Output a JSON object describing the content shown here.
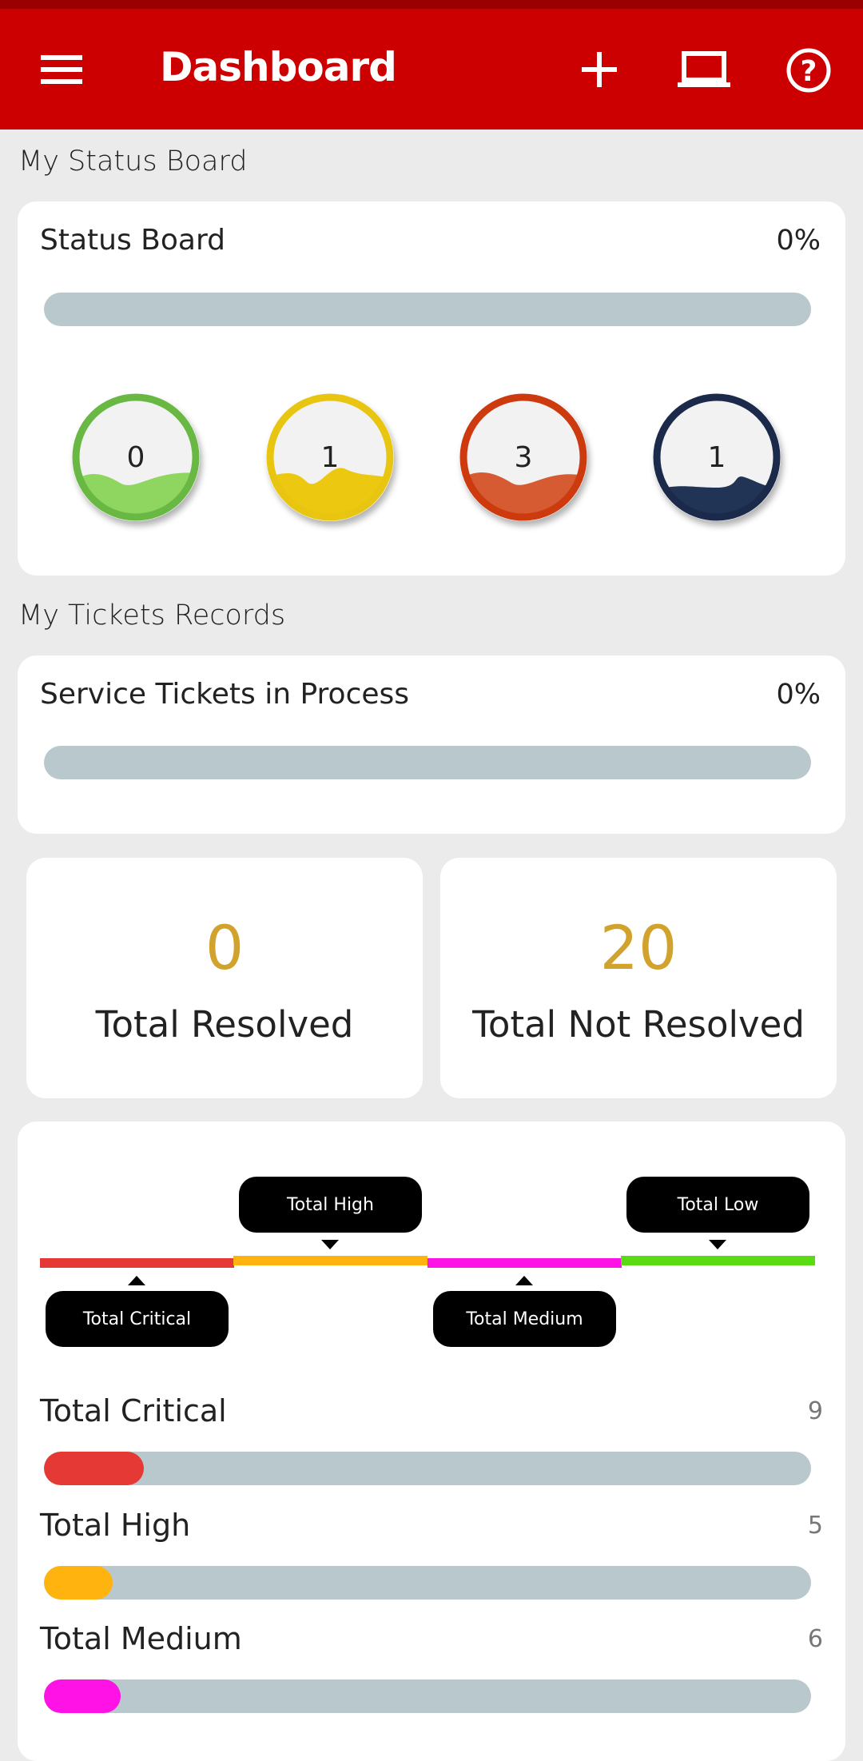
{
  "header": {
    "title": "Dashboard",
    "icons": [
      "menu-icon",
      "plus-icon",
      "laptop-icon",
      "help-icon"
    ]
  },
  "status_section": {
    "heading": "My Status Board",
    "card_title": "Status Board",
    "percent": "0%",
    "progress": 0,
    "circles": [
      {
        "value": "0",
        "border": "#6ab844",
        "wave": "#8ed660"
      },
      {
        "value": "1",
        "border": "#e8c510",
        "wave": "#ecc811"
      },
      {
        "value": "3",
        "border": "#cc3a0e",
        "wave": "#d65a32"
      },
      {
        "value": "1",
        "border": "#1b2a4a",
        "wave": "#213456"
      }
    ]
  },
  "tickets_section": {
    "heading": "My Tickets Records",
    "card_title": "Service Tickets in Process",
    "percent": "0%",
    "progress": 0
  },
  "totals": {
    "resolved": {
      "value": "0",
      "label": "Total Resolved"
    },
    "not_resolved": {
      "value": "20",
      "label": "Total Not Resolved"
    },
    "number_color": "#d2a32c"
  },
  "timeline": {
    "segments": [
      {
        "label": "Total Critical",
        "color": "#e53935"
      },
      {
        "label": "Total High",
        "color": "#ffb30f"
      },
      {
        "label": "Total Medium",
        "color": "#ff12e6"
      },
      {
        "label": "Total Low",
        "color": "#5bdb13"
      }
    ]
  },
  "priority_rows": [
    {
      "label": "Total Critical",
      "value": "9",
      "color": "#e53935",
      "fill_percent": 13
    },
    {
      "label": "Total High",
      "value": "5",
      "color": "#ffb30f",
      "fill_percent": 9
    },
    {
      "label": "Total Medium",
      "value": "6",
      "color": "#ff12e6",
      "fill_percent": 10
    }
  ]
}
